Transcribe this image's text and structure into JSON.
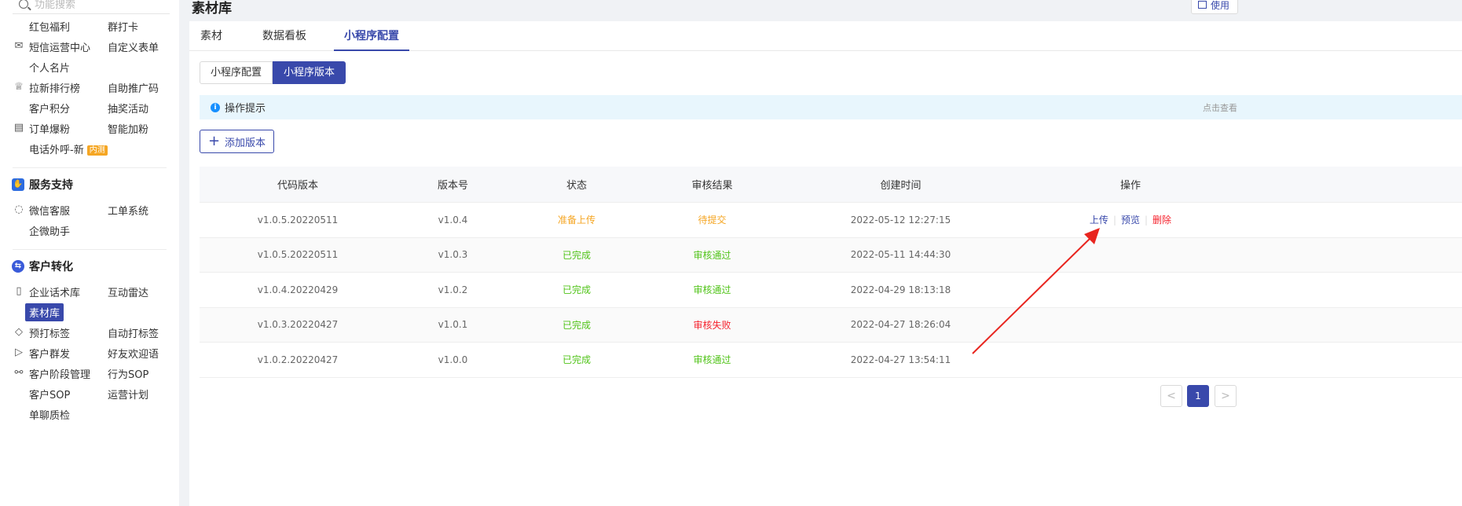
{
  "sidebar": {
    "search_placeholder": "功能搜索",
    "rows": [
      {
        "icon": "",
        "c1": "红包福利",
        "c2": "群打卡"
      },
      {
        "icon": "mail-icon",
        "c1": "短信运营中心",
        "c2": "自定义表单"
      },
      {
        "icon": "",
        "c1": "个人名片",
        "c2": ""
      },
      {
        "icon": "trophy-icon",
        "c1": "拉新排行榜",
        "c2": "自助推广码"
      },
      {
        "icon": "",
        "c1": "客户积分",
        "c2": "抽奖活动"
      },
      {
        "icon": "clipboard-icon",
        "c1": "订单爆粉",
        "c2": "智能加粉"
      },
      {
        "icon": "",
        "c1": "电话外呼-新",
        "c2": "",
        "badge": "内测"
      }
    ],
    "group_service": {
      "label": "服务支持"
    },
    "service_rows": [
      {
        "icon": "chat-icon",
        "c1": "微信客服",
        "c2": "工单系统"
      },
      {
        "icon": "",
        "c1": "企微助手",
        "c2": ""
      }
    ],
    "group_convert": {
      "label": "客户转化"
    },
    "convert_rows": [
      {
        "icon": "book-icon",
        "c1": "企业话术库",
        "c2": "互动雷达"
      },
      {
        "icon": "",
        "c1": "素材库",
        "c2": "",
        "active": true
      },
      {
        "icon": "tag-icon",
        "c1": "预打标签",
        "c2": "自动打标签"
      },
      {
        "icon": "send-icon",
        "c1": "客户群发",
        "c2": "好友欢迎语"
      },
      {
        "icon": "flow-icon",
        "c1": "客户阶段管理",
        "c2": "行为SOP"
      },
      {
        "icon": "",
        "c1": "客户SOP",
        "c2": "运营计划"
      },
      {
        "icon": "",
        "c1": "单聊质检",
        "c2": ""
      }
    ]
  },
  "header": {
    "title": "素材库",
    "usage_label": "使用"
  },
  "tabs": [
    {
      "label": "素材",
      "active": false
    },
    {
      "label": "数据看板",
      "active": false
    },
    {
      "label": "小程序配置",
      "active": true
    }
  ],
  "segment": [
    {
      "label": "小程序配置",
      "active": false
    },
    {
      "label": "小程序版本",
      "active": true
    }
  ],
  "tip": {
    "text": "操作提示",
    "more": "点击查看"
  },
  "add_button": {
    "label": "添加版本"
  },
  "table": {
    "headers": {
      "code": "代码版本",
      "version": "版本号",
      "status": "状态",
      "audit": "审核结果",
      "created": "创建时间",
      "ops": "操作"
    },
    "rows": [
      {
        "code": "v1.0.5.20220511",
        "version": "v1.0.4",
        "status": "准备上传",
        "status_color": "orange",
        "audit": "待提交",
        "audit_color": "orange",
        "created": "2022-05-12 12:27:15",
        "ops": [
          "上传",
          "预览",
          "删除"
        ]
      },
      {
        "code": "v1.0.5.20220511",
        "version": "v1.0.3",
        "status": "已完成",
        "status_color": "green",
        "audit": "审核通过",
        "audit_color": "green",
        "created": "2022-05-11 14:44:30",
        "ops": []
      },
      {
        "code": "v1.0.4.20220429",
        "version": "v1.0.2",
        "status": "已完成",
        "status_color": "green",
        "audit": "审核通过",
        "audit_color": "green",
        "created": "2022-04-29 18:13:18",
        "ops": []
      },
      {
        "code": "v1.0.3.20220427",
        "version": "v1.0.1",
        "status": "已完成",
        "status_color": "green",
        "audit": "审核失败",
        "audit_color": "red",
        "created": "2022-04-27 18:26:04",
        "ops": []
      },
      {
        "code": "v1.0.2.20220427",
        "version": "v1.0.0",
        "status": "已完成",
        "status_color": "green",
        "audit": "审核通过",
        "audit_color": "green",
        "created": "2022-04-27 13:54:11",
        "ops": []
      }
    ]
  },
  "pagination": {
    "prev": "<",
    "current": "1",
    "next": ">"
  },
  "colors": {
    "accent": "#3949ab",
    "orange": "#f5a623",
    "green": "#52c41a",
    "red": "#f5222d",
    "annotation_arrow": "#e8251f"
  }
}
